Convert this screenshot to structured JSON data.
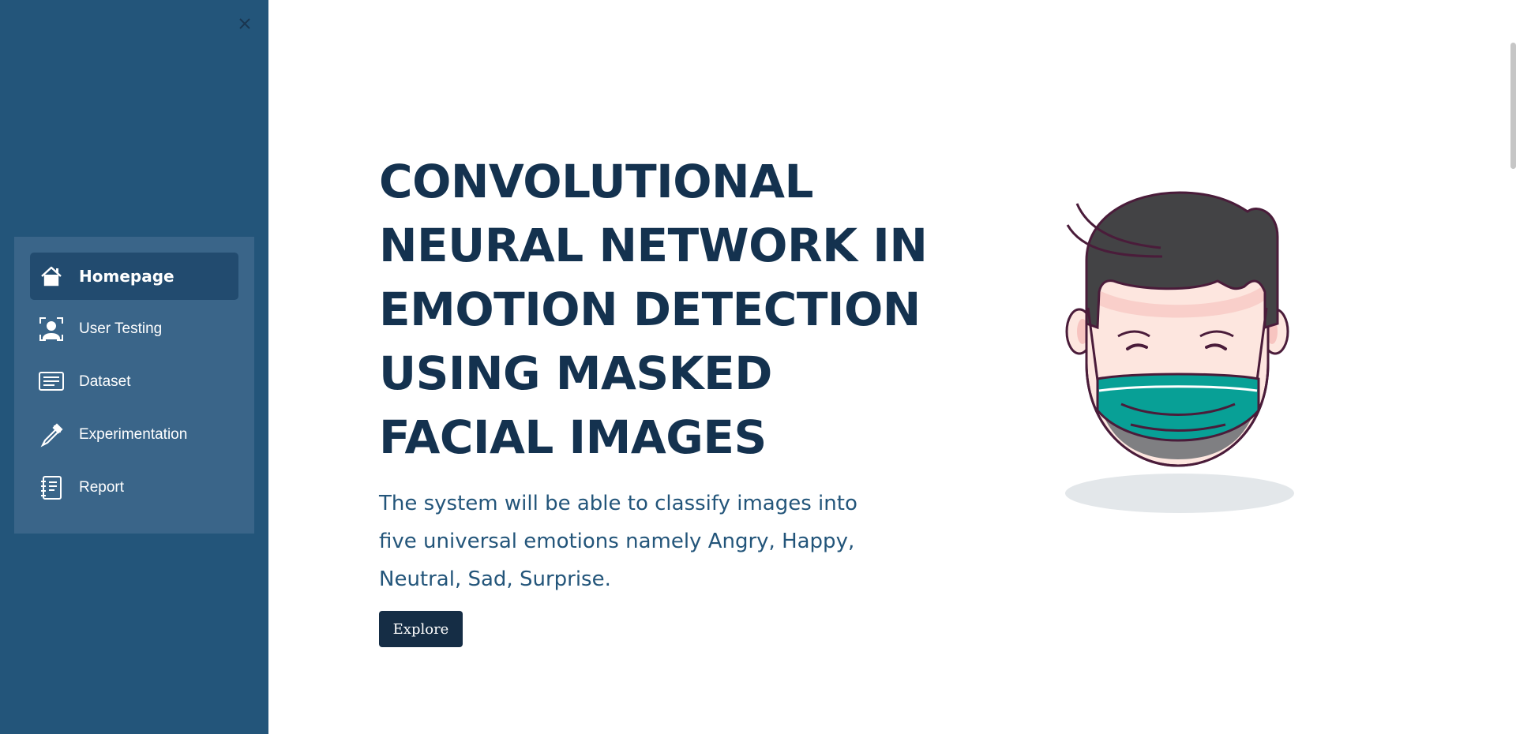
{
  "sidebar": {
    "close_icon": "close-icon",
    "items": [
      {
        "label": "Homepage",
        "icon": "home-icon",
        "active": true
      },
      {
        "label": "User Testing",
        "icon": "user-testing-icon",
        "active": false
      },
      {
        "label": "Dataset",
        "icon": "dataset-icon",
        "active": false
      },
      {
        "label": "Experimentation",
        "icon": "pipette-icon",
        "active": false
      },
      {
        "label": "Report",
        "icon": "report-icon",
        "active": false
      }
    ]
  },
  "hero": {
    "title": "CONVOLUTIONAL NEURAL NETWORK IN EMOTION DETECTION USING MASKED FACIAL IMAGES",
    "subtitle": "The system will be able to classify images into five universal emotions namely Angry, Happy, Neutral, Sad, Surprise.",
    "button_label": "Explore",
    "illustration": "masked-face-illustration"
  },
  "colors": {
    "sidebar_bg": "#23557a",
    "nav_panel_bg": "#3a6589",
    "nav_active_bg": "#224b6f",
    "title_color": "#14324f",
    "subtitle_color": "#23557a",
    "button_bg": "#152d45",
    "mask_color": "#08a096"
  }
}
